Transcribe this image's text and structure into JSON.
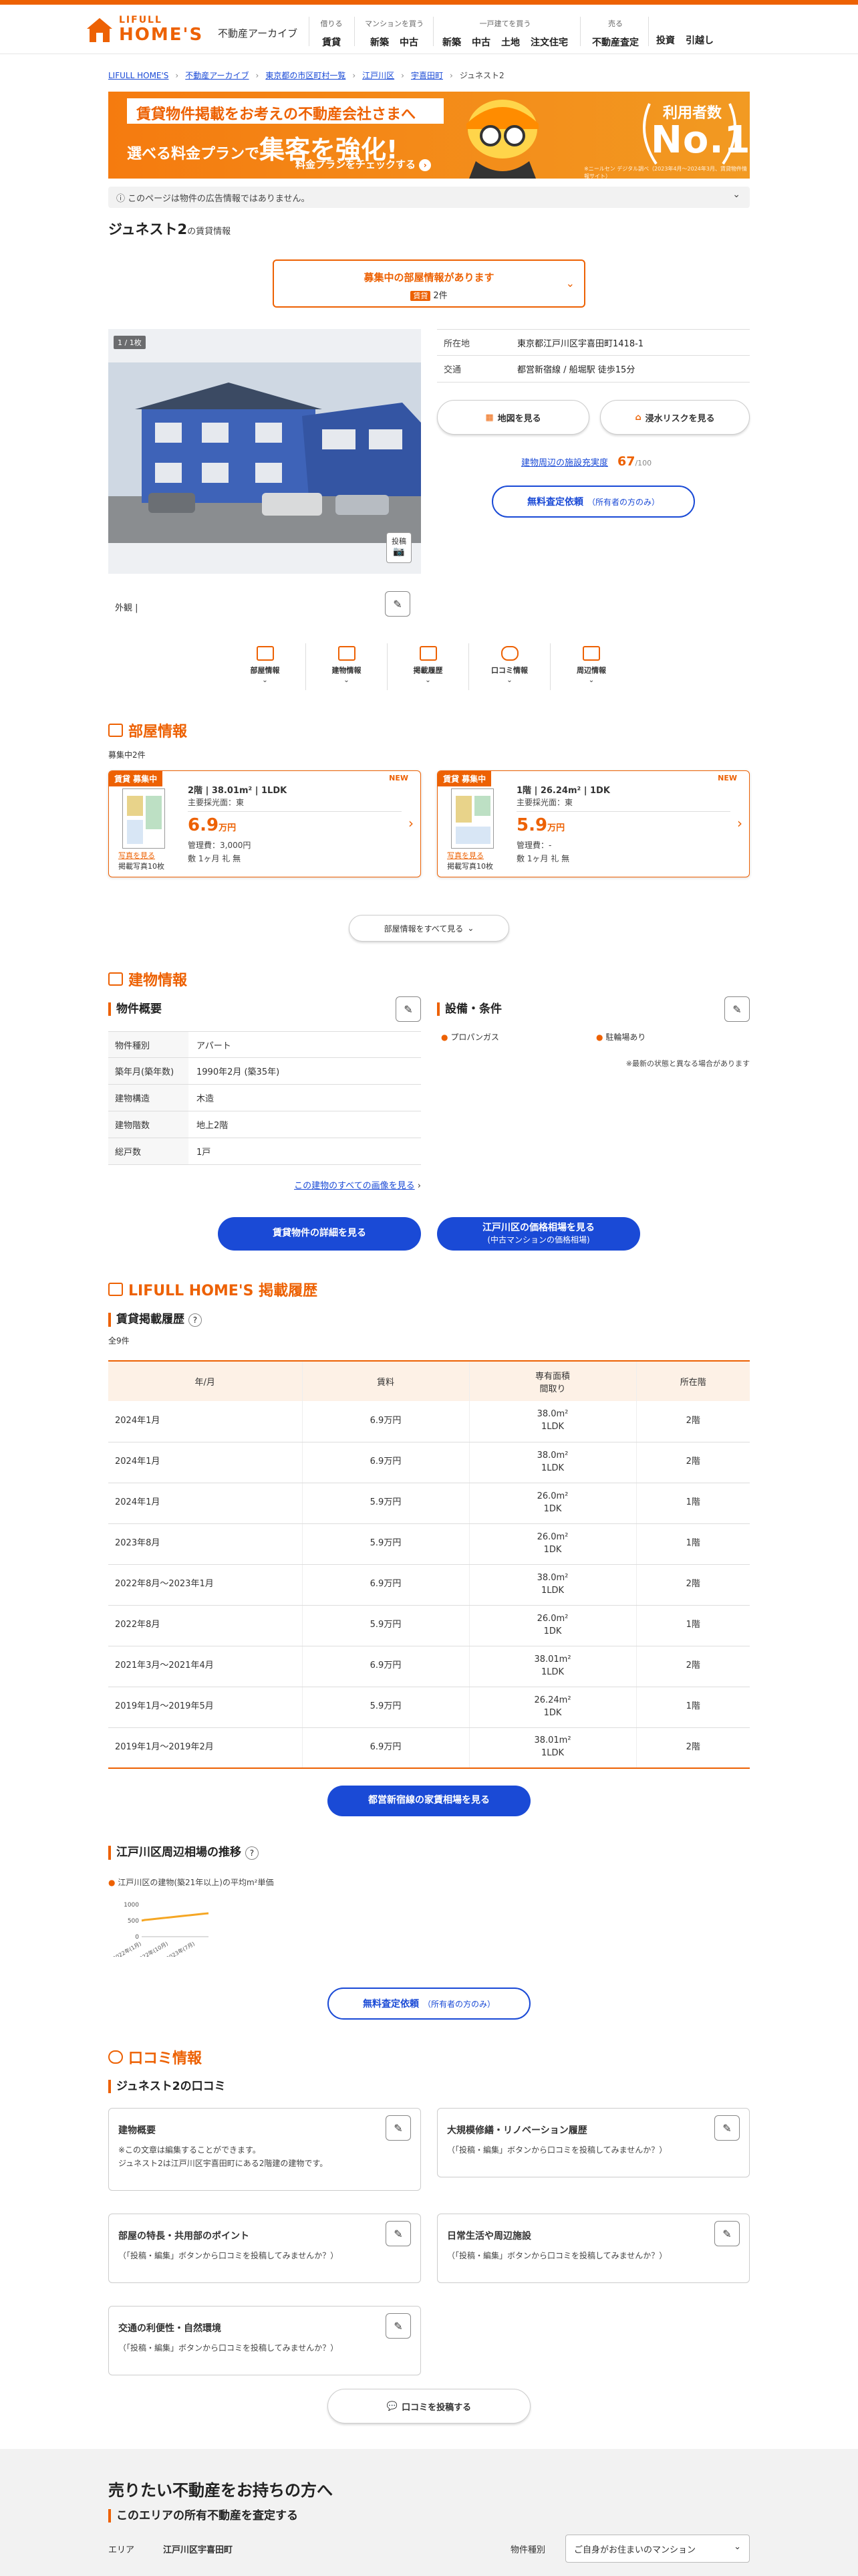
{
  "header": {
    "logo_line1": "LIFULL",
    "logo_line2": "HOME'S",
    "archive_label": "不動産アーカイブ",
    "nav": [
      {
        "caption": "借りる",
        "links": [
          "賃貸"
        ]
      },
      {
        "caption": "マンションを買う",
        "links": [
          "新築",
          "中古"
        ]
      },
      {
        "caption": "一戸建てを買う",
        "links": [
          "新築",
          "中古",
          "土地",
          "注文住宅"
        ]
      },
      {
        "caption": "売る",
        "links": [
          "不動産査定"
        ]
      },
      {
        "caption": "",
        "links": [
          "投資",
          "引越し"
        ]
      }
    ]
  },
  "breadcrumb": [
    "LIFULL HOME'S",
    "不動産アーカイブ",
    "東京都の市区町村一覧",
    "江戸川区",
    "宇喜田町",
    "ジュネスト2"
  ],
  "banner": {
    "line1": "賃貸物件掲載をお考えの不動産会社さまへ",
    "line2_small": "選べる料金プランで",
    "line2_big": "集客を強化!",
    "line3": "料金プランをチェックする",
    "no1_caption": "利用者数",
    "no1": "No.1",
    "fine": "※ニールセン デジタル調べ（2023年4月〜2024年3月、賃貸物件情報サイト）"
  },
  "notice": "このページは物件の広告情報ではありません。",
  "title": {
    "main": "ジュネスト2",
    "sub": "の賃貸情報"
  },
  "vacancy": {
    "title": "募集中の部屋情報があります",
    "tag": "賃貸",
    "count": "2件"
  },
  "photo": {
    "counter": "1 / 1枚",
    "post_label": "投稿",
    "caption": "外観"
  },
  "info": [
    {
      "label": "所在地",
      "value": "東京都江戸川区宇喜田町1418-1"
    },
    {
      "label": "交通",
      "value": "都営新宿線 / 船堀駅 徒歩15分"
    }
  ],
  "buttons": {
    "map": "地図を見る",
    "flood": "浸水リスクを見る",
    "facility_link": "建物周辺の施設充実度",
    "facility_score": "67",
    "facility_max": "/100",
    "appraisal": "無料査定依頼",
    "appraisal_note": "（所有者の方のみ）"
  },
  "anchors": [
    "部屋情報",
    "建物情報",
    "掲載履歴",
    "口コミ情報",
    "周辺情報"
  ],
  "rooms_section": {
    "title": "部屋情報",
    "count": "募集中2件",
    "rooms": [
      {
        "tag": "賃貸 募集中",
        "new": "NEW",
        "floor_info": "2階 | 38.01m² | 1LDK",
        "direction": "主要採光面：東",
        "price": "6.9",
        "unit": "万円",
        "fee": "管理費：3,000円",
        "deposit": "敷 1ヶ月  礼 無",
        "more": "写真を見る",
        "photo_count": "掲載写真10枚"
      },
      {
        "tag": "賃貸 募集中",
        "new": "NEW",
        "floor_info": "1階 | 26.24m² | 1DK",
        "direction": "主要採光面：東",
        "price": "5.9",
        "unit": "万円",
        "fee": "管理費：-",
        "deposit": "敷 1ヶ月  礼 無",
        "more": "写真を見る",
        "photo_count": "掲載写真10枚"
      }
    ],
    "show_all": "部屋情報をすべて見る"
  },
  "building_section": {
    "title": "建物情報",
    "overview_title": "物件概要",
    "overview": [
      {
        "label": "物件種別",
        "value": "アパート"
      },
      {
        "label": "築年月(築年数)",
        "value": "1990年2月 (築35年)"
      },
      {
        "label": "建物構造",
        "value": "木造"
      },
      {
        "label": "建物階数",
        "value": "地上2階"
      },
      {
        "label": "総戸数",
        "value": "1戸"
      }
    ],
    "all_images_link": "この建物のすべての画像を見る",
    "equip_title": "設備・条件",
    "equip": [
      "プロパンガス",
      "駐輪場あり"
    ],
    "equip_note": "※最新の状態と異なる場合があります",
    "btn_detail": "賃貸物件の詳細を見る",
    "btn_price": "江戸川区の価格相場を見る",
    "btn_price_sub": "(中古マンションの価格相場)"
  },
  "history_section": {
    "title": "LIFULL HOME'S 掲載履歴",
    "sub": "賃貸掲載履歴",
    "count": "全9件",
    "headers": [
      "年/月",
      "賃料",
      "専有面積\n間取り",
      "所在階"
    ],
    "rows": [
      [
        "2024年1月",
        "6.9万円",
        "38.0m²\n1LDK",
        "2階"
      ],
      [
        "2024年1月",
        "6.9万円",
        "38.0m²\n1LDK",
        "2階"
      ],
      [
        "2024年1月",
        "5.9万円",
        "26.0m²\n1DK",
        "1階"
      ],
      [
        "2023年8月",
        "5.9万円",
        "26.0m²\n1DK",
        "1階"
      ],
      [
        "2022年8月〜2023年1月",
        "6.9万円",
        "38.0m²\n1LDK",
        "2階"
      ],
      [
        "2022年8月",
        "5.9万円",
        "26.0m²\n1DK",
        "1階"
      ],
      [
        "2021年3月〜2021年4月",
        "6.9万円",
        "38.01m²\n1LDK",
        "2階"
      ],
      [
        "2019年1月〜2019年5月",
        "5.9万円",
        "26.24m²\n1DK",
        "1階"
      ],
      [
        "2019年1月〜2019年2月",
        "6.9万円",
        "38.01m²\n1LDK",
        "2階"
      ]
    ],
    "btn_market": "都営新宿線の家賃相場を見る"
  },
  "trend": {
    "title": "江戸川区周辺相場の推移",
    "legend": "江戸川区の建物(築21年以上)の平均m²単価",
    "color": "#f5a623"
  },
  "chart_data": {
    "type": "line",
    "title": "",
    "series": [
      {
        "name": "江戸川区の建物(築21年以上)の平均m²単価",
        "values": [
          500,
          520,
          530,
          540,
          550,
          560,
          570,
          580,
          590,
          600,
          610,
          620,
          630,
          640,
          650,
          660,
          670,
          680,
          690,
          700,
          710,
          720,
          730
        ]
      }
    ],
    "x_tick_labels": [
      "2022年(1月)",
      "2022年(10月)",
      "2023年(7月)"
    ],
    "y_tick_labels": [
      "1000",
      "500",
      "0"
    ],
    "ylim": [
      0,
      1000
    ],
    "grid": false
  },
  "appraisal2": {
    "label": "無料査定依頼",
    "note": "（所有者の方のみ）"
  },
  "reviews_section": {
    "title": "口コミ情報",
    "sub": "ジュネスト2の口コミ",
    "cards": [
      {
        "title": "建物概要",
        "desc": "※この文章は編集することができます。\nジュネスト2は江戸川区宇喜田町にある2階建の建物です。"
      },
      {
        "title": "大規模修繕・リノベーション履歴",
        "desc": "（「投稿・編集」ボタンから口コミを投稿してみませんか？）"
      },
      {
        "title": "部屋の特長・共用部のポイント",
        "desc": "（「投稿・編集」ボタンから口コミを投稿してみませんか？）"
      },
      {
        "title": "日常生活や周辺施設",
        "desc": "（「投稿・編集」ボタンから口コミを投稿してみませんか？）"
      },
      {
        "title": "交通の利便性・自然環境",
        "desc": "（「投稿・編集」ボタンから口コミを投稿してみませんか？）"
      }
    ],
    "post_btn": "口コミを投稿する"
  },
  "sell": {
    "title": "売りたい不動産をお持ちの方へ",
    "sub": "このエリアの所有不動産を査定する",
    "area_label": "エリア",
    "area_value": "江戸川区宇喜田町",
    "type_label": "物件種別",
    "type_value": "ご自身がお住まいのマンション"
  }
}
